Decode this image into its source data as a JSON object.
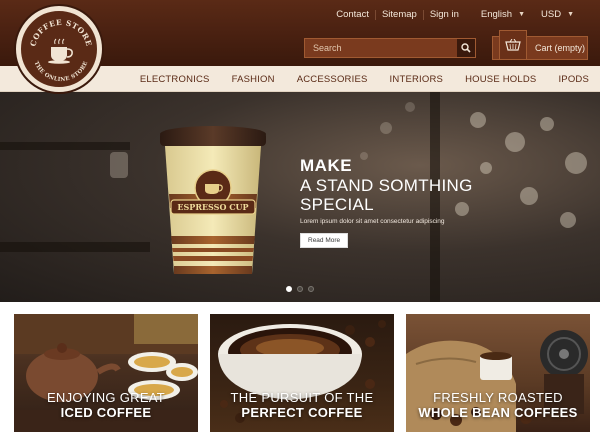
{
  "header": {
    "logo": {
      "top_text": "COFFEE STORE",
      "bottom_text": "THE ONLINE STORE"
    },
    "top_links": [
      "Contact",
      "Sitemap",
      "Sign in"
    ],
    "language": "English",
    "currency": "USD",
    "search": {
      "placeholder": "Search"
    },
    "cart": {
      "label": "Cart (empty)"
    }
  },
  "nav": {
    "items": [
      "ELECTRONICS",
      "FASHION",
      "ACCESSORIES",
      "INTERIORS",
      "HOUSE HOLDS",
      "IPODS"
    ]
  },
  "hero": {
    "headline": "MAKE",
    "subheadline_1": "A STAND SOMTHING",
    "subheadline_2": "SPECIAL",
    "text": "Lorem ipsum dolor sit amet consectetur adipiscing",
    "button": "Read More",
    "cup_label": "ESPRESSO CUP",
    "slides": 3,
    "active_slide": 1
  },
  "cards": [
    {
      "line1": "ENJOYING GREAT",
      "line2": "ICED COFFEE"
    },
    {
      "line1": "THE PURSUIT OF THE",
      "line2": "PERFECT COFFEE"
    },
    {
      "line1": "FRESHLY ROASTED",
      "line2": "WHOLE BEAN COFFEES"
    }
  ],
  "colors": {
    "brand_brown": "#5a2a16",
    "cream": "#f3e9dc",
    "dark": "#3a190c"
  }
}
